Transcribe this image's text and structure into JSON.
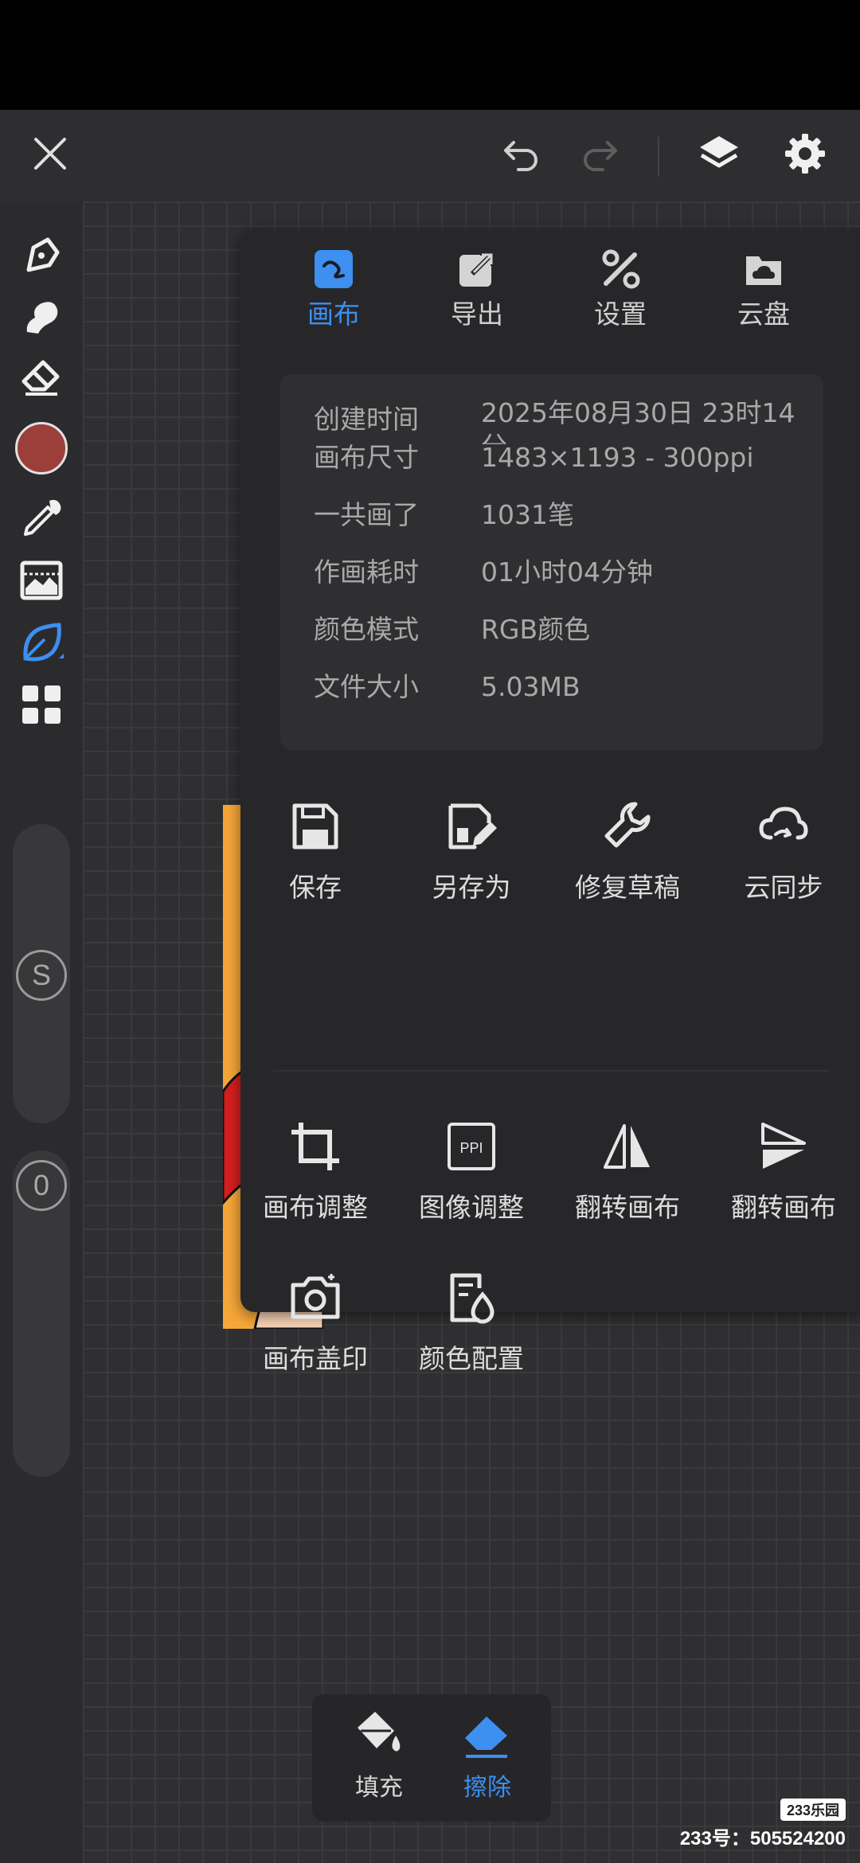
{
  "colors": {
    "accent": "#3d8ff0",
    "panel_bg": "#27272a",
    "brush_color": "#9c3e3a"
  },
  "topbar": {
    "close_icon": "close-icon",
    "undo_icon": "undo-icon",
    "redo_icon": "redo-icon",
    "layers_icon": "layers-icon",
    "settings_icon": "gear-icon"
  },
  "left_toolbar": {
    "tools": [
      "pen-icon",
      "smudge-icon",
      "eraser-icon",
      "color-swatch",
      "eyedropper-icon",
      "image-adjust-icon",
      "leaf-brush-icon",
      "grid-menu-icon"
    ],
    "size_slider_label": "S",
    "opacity_slider_label": "0"
  },
  "panel": {
    "tabs": [
      {
        "label": "画布",
        "icon": "canvas-icon",
        "active": true
      },
      {
        "label": "导出",
        "icon": "export-icon",
        "active": false
      },
      {
        "label": "设置",
        "icon": "tools-icon",
        "active": false
      },
      {
        "label": "云盘",
        "icon": "cloud-folder-icon",
        "active": false
      }
    ],
    "info": [
      {
        "key": "创建时间",
        "value": "2025年08月30日 23时14分"
      },
      {
        "key": "画布尺寸",
        "value": "1483×1193 - 300ppi"
      },
      {
        "key": "一共画了",
        "value": "1031笔"
      },
      {
        "key": "作画耗时",
        "value": "01小时04分钟"
      },
      {
        "key": "颜色模式",
        "value": "RGB颜色"
      },
      {
        "key": "文件大小",
        "value": "5.03MB"
      }
    ],
    "actions_row1": [
      {
        "label": "保存",
        "icon": "save-icon"
      },
      {
        "label": "另存为",
        "icon": "save-as-icon"
      },
      {
        "label": "修复草稿",
        "icon": "wrench-icon"
      },
      {
        "label": "云同步",
        "icon": "cloud-sync-icon"
      }
    ],
    "actions_row2": [
      {
        "label": "画布调整",
        "icon": "crop-icon"
      },
      {
        "label": "图像调整",
        "icon": "ppi-icon",
        "icon_text": "PPI"
      },
      {
        "label": "翻转画布",
        "icon": "flip-horizontal-icon"
      },
      {
        "label": "翻转画布",
        "icon": "flip-vertical-icon"
      }
    ],
    "actions_row3": [
      {
        "label": "画布盖印",
        "icon": "camera-icon"
      },
      {
        "label": "颜色配置",
        "icon": "color-profile-icon"
      }
    ]
  },
  "bottom_popup": {
    "fill_label": "填充",
    "erase_label": "擦除"
  },
  "watermark": {
    "logo": "233乐园",
    "text": "233号：505524200"
  }
}
